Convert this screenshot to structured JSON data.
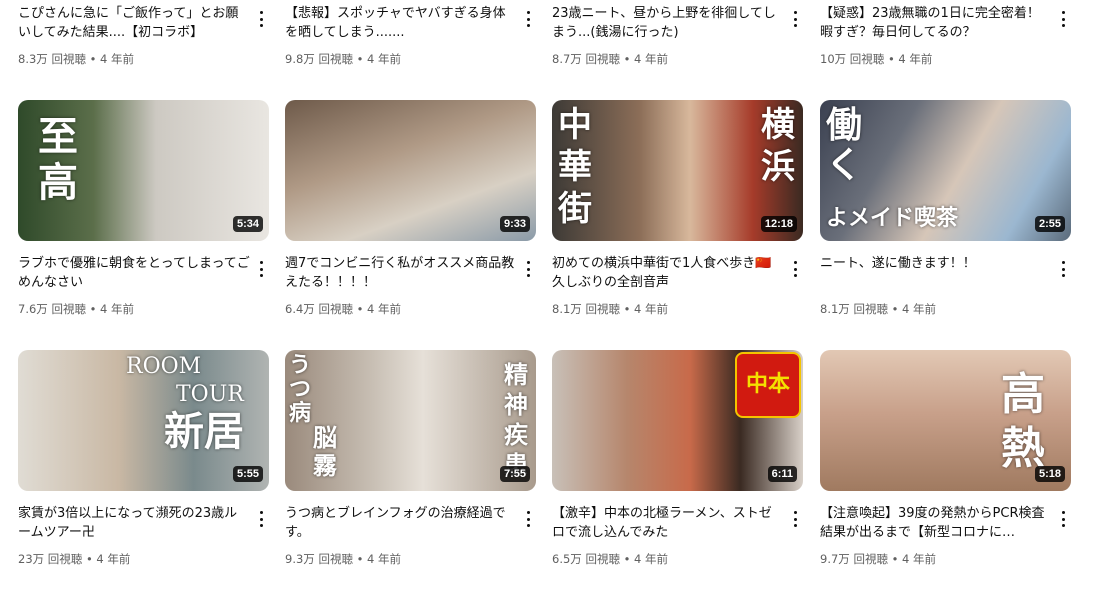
{
  "top_row": [
    {
      "title": "こぴさんに急に「ご飯作って」とお願いしてみた結果....【初コラボ】",
      "meta": "8.3万 回視聴 • 4 年前"
    },
    {
      "title": "【悲報】スポッチャでヤバすぎる身体を晒してしまう.......",
      "meta": "9.8万 回視聴 • 4 年前"
    },
    {
      "title": "23歳ニート、昼から上野を徘徊してしまう...(銭湯に行った)",
      "meta": "8.7万 回視聴 • 4 年前"
    },
    {
      "title": "【疑惑】23歳無職の1日に完全密着！暇すぎ？毎日何してるの？",
      "meta": "10万 回視聴 • 4 年前"
    }
  ],
  "row2": [
    {
      "title": "ラブホで優雅に朝食をとってしまってごめんなさい",
      "meta": "7.6万 回視聴 • 4 年前",
      "duration": "5:34",
      "overlay": "至高"
    },
    {
      "title": "週7でコンビニ行く私がオススメ商品教えたる！！！！",
      "meta": "6.4万 回視聴 • 4 年前",
      "duration": "9:33"
    },
    {
      "title": "初めての横浜中華街で1人食べ歩き🇨🇳久しぶりの全剖音声",
      "meta": "8.1万 回視聴 • 4 年前",
      "duration": "12:18",
      "overlay_left": "中華街",
      "overlay_right": "横浜"
    },
    {
      "title": "ニート、遂に働きます！！",
      "meta": "8.1万 回視聴 • 4 年前",
      "duration": "2:55",
      "overlay_top": "働く",
      "overlay_bottom": "よメイド喫茶"
    }
  ],
  "row3": [
    {
      "title": "家賃が3倍以上になって瀕死の23歳ルームツアー卍",
      "meta": "23万 回視聴 • 4 年前",
      "duration": "5:55",
      "overlay_en1": "ROOM",
      "overlay_en2": "TOUR",
      "overlay_jp": "新居"
    },
    {
      "title": "うつ病とブレインフォグの治療経過です。",
      "meta": "9.3万 回視聴 • 4 年前",
      "duration": "7:55",
      "overlay_left": "うつ病",
      "overlay_mid": "脳霧",
      "overlay_right": "精神疾患"
    },
    {
      "title": "【激辛】中本の北極ラーメン、ストゼロで流し込んでみた",
      "meta": "6.5万 回視聴 • 4 年前",
      "duration": "6:11",
      "overlay_logo": "中本"
    },
    {
      "title": "【注意喚起】39度の発熱からPCR検査結果が出るまで【新型コロナに…",
      "meta": "9.7万 回視聴 • 4 年前",
      "duration": "5:18",
      "overlay": "高熱"
    }
  ],
  "icons": {
    "menu": "more-vert-icon"
  },
  "colors": {
    "meta": "#606060",
    "title": "#0f0f0f",
    "duration_bg": "#000000cc"
  }
}
